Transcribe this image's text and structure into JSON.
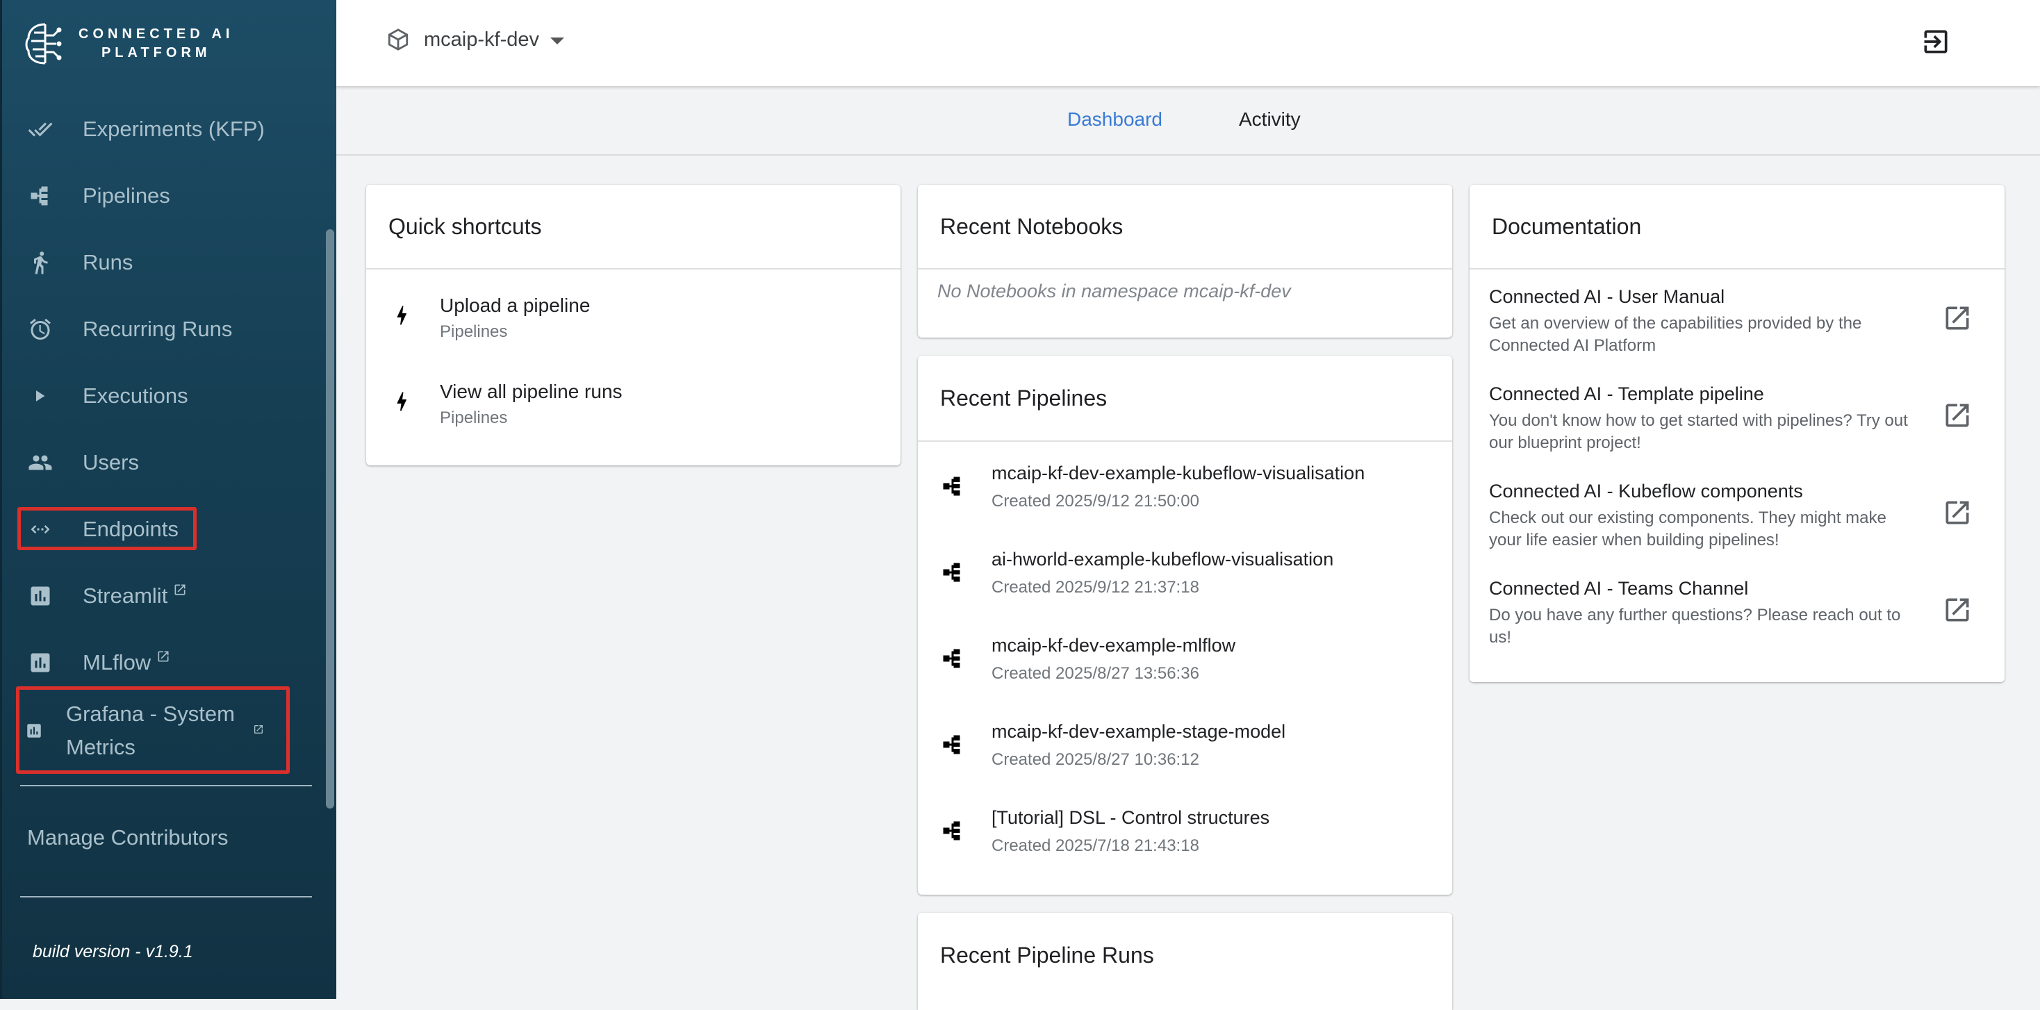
{
  "brand": {
    "line1": "CONNECTED AI",
    "line2": "PLATFORM"
  },
  "sidebar": {
    "items": [
      {
        "label": "Experiments (KFP)",
        "icon": "done-all-icon"
      },
      {
        "label": "Pipelines",
        "icon": "pipeline-icon"
      },
      {
        "label": "Runs",
        "icon": "directions-run-icon"
      },
      {
        "label": "Recurring Runs",
        "icon": "alarm-icon"
      },
      {
        "label": "Executions",
        "icon": "play-arrow-icon"
      },
      {
        "label": "Users",
        "icon": "group-icon"
      },
      {
        "label": "Endpoints",
        "icon": "code-arrows-icon",
        "highlighted": true
      },
      {
        "label": "Streamlit",
        "icon": "bar-chart-icon",
        "external": true
      },
      {
        "label": "MLflow",
        "icon": "bar-chart-icon",
        "external": true
      },
      {
        "label": "Grafana - System Metrics",
        "line1": "Grafana - System",
        "line2": "Metrics",
        "icon": "bar-chart-icon",
        "external": true,
        "highlighted": true
      }
    ],
    "manage_contributors": "Manage Contributors",
    "build_version": "build version - v1.9.1"
  },
  "topbar": {
    "namespace": "mcaip-kf-dev",
    "namespace_icon": "cube-icon",
    "logout_icon": "logout-icon"
  },
  "tabs": [
    {
      "label": "Dashboard",
      "active": true
    },
    {
      "label": "Activity",
      "active": false
    }
  ],
  "quick_shortcuts": {
    "title": "Quick shortcuts",
    "items": [
      {
        "title": "Upload a pipeline",
        "subtitle": "Pipelines"
      },
      {
        "title": "View all pipeline runs",
        "subtitle": "Pipelines"
      }
    ]
  },
  "recent_notebooks": {
    "title": "Recent Notebooks",
    "empty_text": "No Notebooks in namespace mcaip-kf-dev"
  },
  "recent_pipelines": {
    "title": "Recent Pipelines",
    "items": [
      {
        "name": "mcaip-kf-dev-example-kubeflow-visualisation",
        "created": "Created 2025/9/12 21:50:00"
      },
      {
        "name": "ai-hworld-example-kubeflow-visualisation",
        "created": "Created 2025/9/12 21:37:18"
      },
      {
        "name": "mcaip-kf-dev-example-mlflow",
        "created": "Created 2025/8/27 13:56:36"
      },
      {
        "name": "mcaip-kf-dev-example-stage-model",
        "created": "Created 2025/8/27 10:36:12"
      },
      {
        "name": "[Tutorial] DSL - Control structures",
        "created": "Created 2025/7/18 21:43:18"
      }
    ]
  },
  "recent_pipeline_runs": {
    "title": "Recent Pipeline Runs"
  },
  "documentation": {
    "title": "Documentation",
    "items": [
      {
        "title": "Connected AI - User Manual",
        "desc": "Get an overview of the capabilities provided by the Connected AI Platform"
      },
      {
        "title": "Connected AI - Template pipeline",
        "desc": "You don't know how to get started with pipelines? Try out our blueprint project!"
      },
      {
        "title": "Connected AI - Kubeflow components",
        "desc": "Check out our existing components. They might make your life easier when building pipelines!"
      },
      {
        "title": "Connected AI - Teams Channel",
        "desc": "Do you have any further questions? Please reach out to us!"
      }
    ]
  },
  "colors": {
    "sidebar_top": "#1d4d66",
    "sidebar_bottom": "#113243",
    "accent": "#3a7bd5",
    "highlight": "#d9302c"
  }
}
